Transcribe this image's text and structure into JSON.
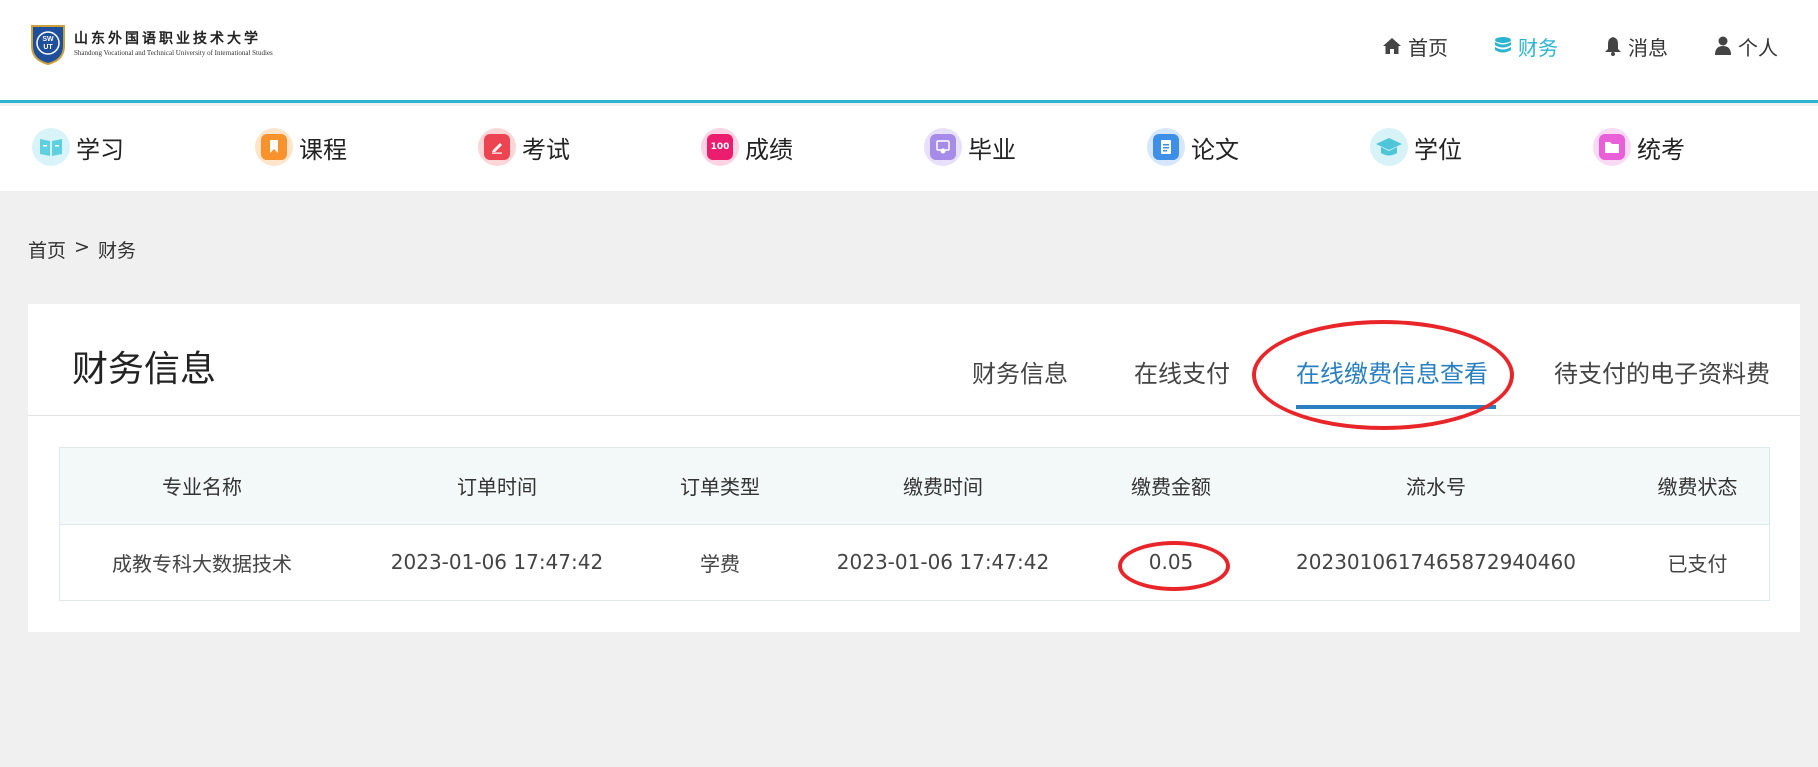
{
  "header": {
    "logo_cn": "山东外国语职业技术大学",
    "logo_en": "Shandong Vocational and Technical University of International Studies",
    "logo_seal": "SWUT",
    "nav": [
      {
        "label": "首页",
        "icon": "home-icon"
      },
      {
        "label": "财务",
        "icon": "database-icon",
        "active": true
      },
      {
        "label": "消息",
        "icon": "bell-icon"
      },
      {
        "label": "个人",
        "icon": "user-icon"
      }
    ]
  },
  "categories": [
    {
      "label": "学习",
      "icon": "book-icon",
      "color": "#5fd0e0",
      "ring": "#d9f4f8"
    },
    {
      "label": "课程",
      "icon": "bookmark-icon",
      "color": "#f7922c",
      "ring": "#fde5cc"
    },
    {
      "label": "考试",
      "icon": "pen-icon",
      "color": "#ec4450",
      "ring": "#fbd6d9"
    },
    {
      "label": "成绩",
      "icon": "score-icon",
      "color": "#ea1d6f",
      "ring": "#fbd3e3",
      "badge": "100"
    },
    {
      "label": "毕业",
      "icon": "certificate-icon",
      "color": "#a78be8",
      "ring": "#e8e0fa"
    },
    {
      "label": "论文",
      "icon": "document-icon",
      "color": "#3d8fe8",
      "ring": "#d6e7fb"
    },
    {
      "label": "学位",
      "icon": "graduation-cap-icon",
      "color": "#4fc6d8",
      "ring": "#d8f3f7"
    },
    {
      "label": "统考",
      "icon": "folder-icon",
      "color": "#e85fd8",
      "ring": "#f9daf5"
    }
  ],
  "breadcrumb": {
    "home": "首页",
    "sep": ">",
    "current": "财务"
  },
  "panel": {
    "title": "财务信息",
    "tabs": [
      {
        "label": "财务信息"
      },
      {
        "label": "在线支付"
      },
      {
        "label": "在线缴费信息查看",
        "active": true
      },
      {
        "label": "待支付的电子资料费"
      }
    ]
  },
  "table": {
    "columns": [
      "专业名称",
      "订单时间",
      "订单类型",
      "缴费时间",
      "缴费金额",
      "流水号",
      "缴费状态"
    ],
    "rows": [
      [
        "成教专科大数据技术",
        "2023-01-06 17:47:42",
        "学费",
        "2023-01-06 17:47:42",
        "0.05",
        "20230106174658729404​60",
        "已支付"
      ]
    ]
  },
  "colors": {
    "accent": "#2bb3d0",
    "tab_active": "#2a7fc0",
    "annotation": "#e8262a"
  }
}
